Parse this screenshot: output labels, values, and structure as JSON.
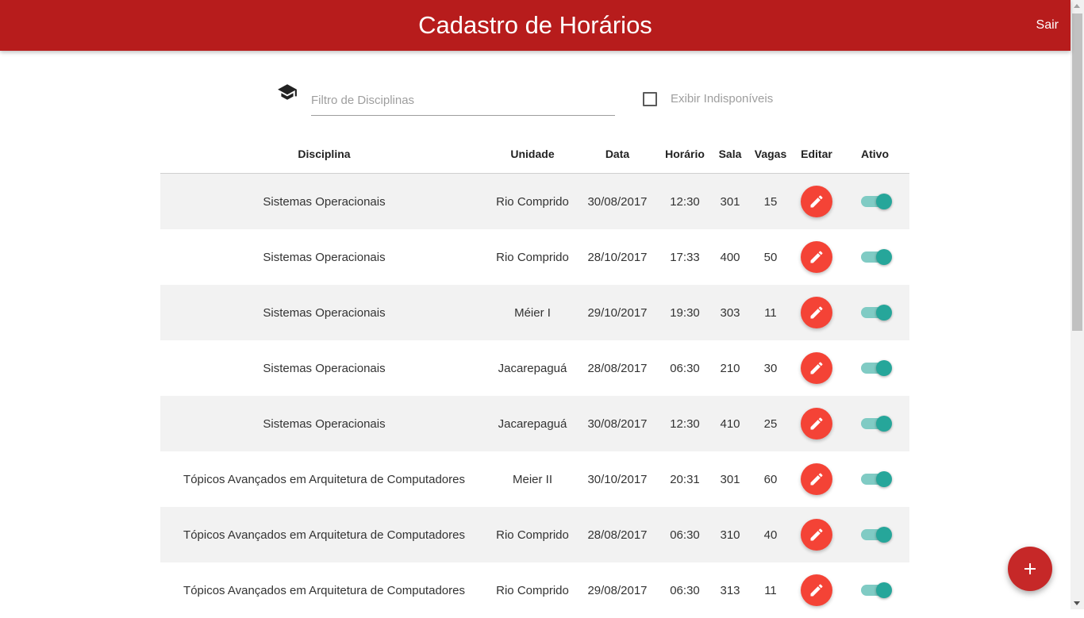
{
  "header": {
    "title": "Cadastro de Horários",
    "logout_label": "Sair"
  },
  "filter": {
    "placeholder": "Filtro de Disciplinas",
    "icon": "graduation-cap-icon",
    "show_unavailable_label": "Exibir Indisponíveis",
    "show_unavailable_checked": false
  },
  "table": {
    "columns": [
      "Disciplina",
      "Unidade",
      "Data",
      "Horário",
      "Sala",
      "Vagas",
      "Editar",
      "Ativo"
    ],
    "rows": [
      {
        "disciplina": "Sistemas Operacionais",
        "unidade": "Rio Comprido",
        "data": "30/08/2017",
        "horario": "12:30",
        "sala": "301",
        "vagas": "15",
        "ativo": true
      },
      {
        "disciplina": "Sistemas Operacionais",
        "unidade": "Rio Comprido",
        "data": "28/10/2017",
        "horario": "17:33",
        "sala": "400",
        "vagas": "50",
        "ativo": true
      },
      {
        "disciplina": "Sistemas Operacionais",
        "unidade": "Méier I",
        "data": "29/10/2017",
        "horario": "19:30",
        "sala": "303",
        "vagas": "11",
        "ativo": true
      },
      {
        "disciplina": "Sistemas Operacionais",
        "unidade": "Jacarepaguá",
        "data": "28/08/2017",
        "horario": "06:30",
        "sala": "210",
        "vagas": "30",
        "ativo": true
      },
      {
        "disciplina": "Sistemas Operacionais",
        "unidade": "Jacarepaguá",
        "data": "30/08/2017",
        "horario": "12:30",
        "sala": "410",
        "vagas": "25",
        "ativo": true
      },
      {
        "disciplina": "Tópicos Avançados em Arquitetura de Computadores",
        "unidade": "Meier II",
        "data": "30/10/2017",
        "horario": "20:31",
        "sala": "301",
        "vagas": "60",
        "ativo": true
      },
      {
        "disciplina": "Tópicos Avançados em Arquitetura de Computadores",
        "unidade": "Rio Comprido",
        "data": "28/08/2017",
        "horario": "06:30",
        "sala": "310",
        "vagas": "40",
        "ativo": true
      },
      {
        "disciplina": "Tópicos Avançados em Arquitetura de Computadores",
        "unidade": "Rio Comprido",
        "data": "29/08/2017",
        "horario": "06:30",
        "sala": "313",
        "vagas": "11",
        "ativo": true
      }
    ]
  },
  "colors": {
    "header": "#b71c1c",
    "edit_button": "#f44336",
    "fab": "#c62828",
    "switch_on": "#26a69a"
  },
  "fab": {
    "icon": "plus-icon"
  }
}
